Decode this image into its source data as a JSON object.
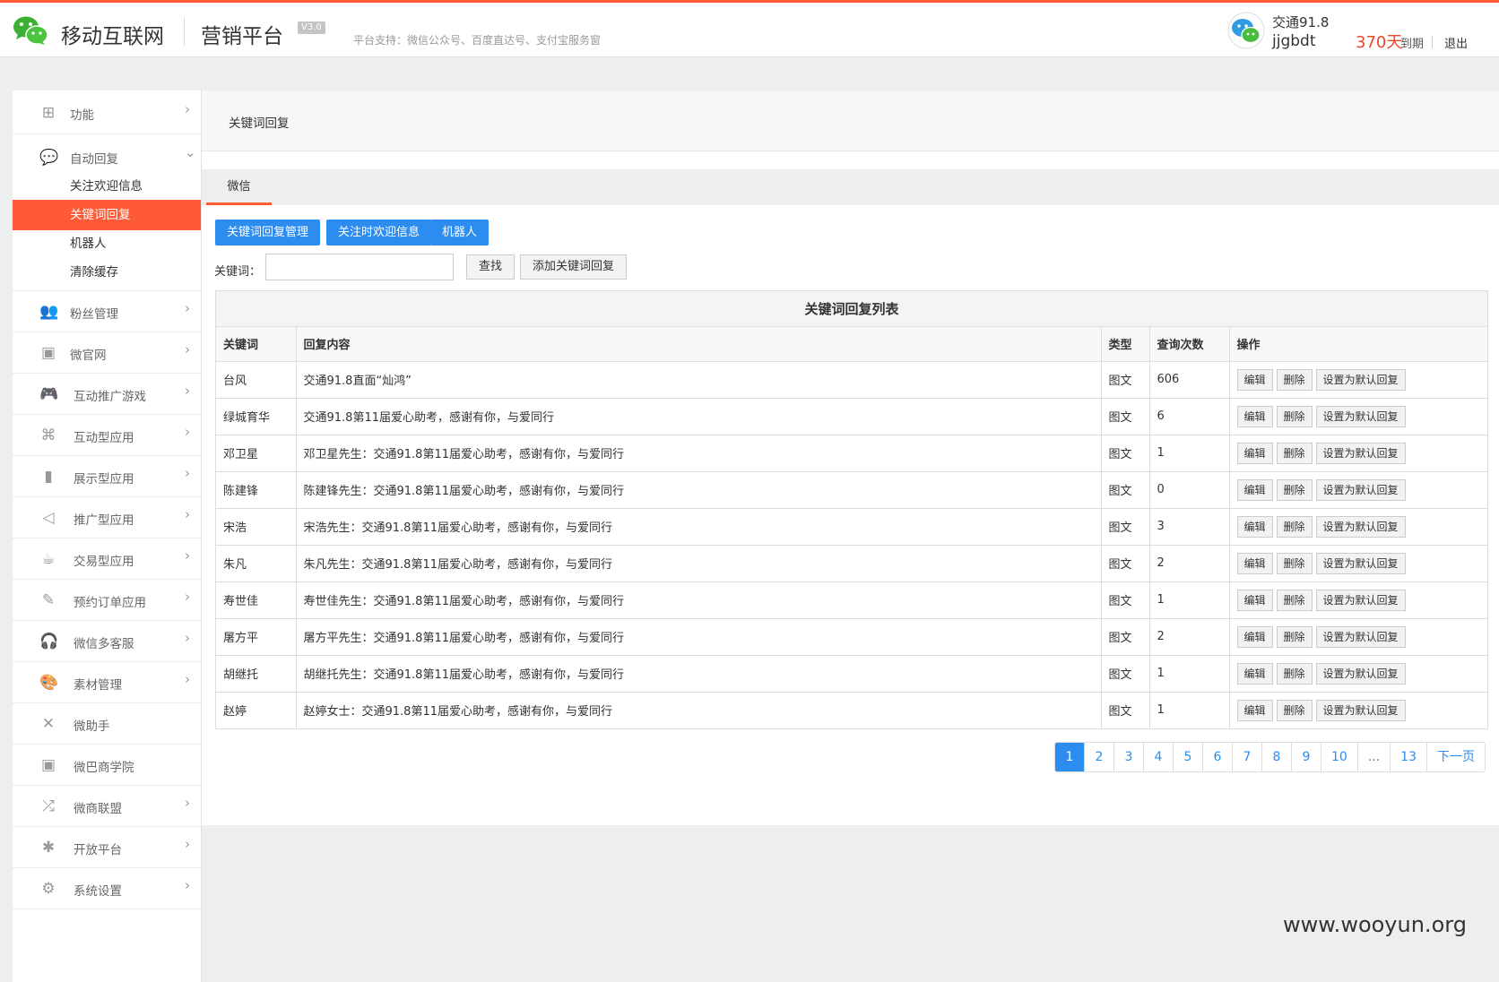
{
  "header": {
    "brand": "移动互联网",
    "platform": "营销平台",
    "version": "V3.0",
    "support": "平台支持：微信公众号、百度直达号、支付宝服务窗",
    "user_name": "交通91.8",
    "user_login": "jjgbdt",
    "days": "370天",
    "days_label": "到期",
    "logout": "退出",
    "accent_color": "#ff5a36"
  },
  "sidebar": {
    "top": [
      {
        "label": "功能",
        "icon": "grid-icon"
      },
      {
        "label": "自动回复",
        "icon": "chat-icon"
      }
    ],
    "sub": [
      {
        "label": "关注欢迎信息"
      },
      {
        "label": "关键词回复"
      },
      {
        "label": "机器人"
      },
      {
        "label": "清除缓存"
      }
    ],
    "items": [
      {
        "label": "粉丝管理",
        "icon": "users-icon"
      },
      {
        "label": "微官网",
        "icon": "web-icon"
      },
      {
        "label": "互动推广游戏",
        "icon": "gamepad-icon"
      },
      {
        "label": "互动型应用",
        "icon": "command-icon"
      },
      {
        "label": "展示型应用",
        "icon": "book-icon"
      },
      {
        "label": "推广型应用",
        "icon": "share-icon"
      },
      {
        "label": "交易型应用",
        "icon": "cart-icon"
      },
      {
        "label": "预约订单应用",
        "icon": "edit-icon"
      },
      {
        "label": "微信多客服",
        "icon": "headset-icon"
      },
      {
        "label": "素材管理",
        "icon": "palette-icon"
      },
      {
        "label": "微助手",
        "icon": "tools-icon"
      },
      {
        "label": "微巴商学院",
        "icon": "school-icon"
      },
      {
        "label": "微商联盟",
        "icon": "shuffle-icon"
      },
      {
        "label": "开放平台",
        "icon": "puzzle-icon"
      },
      {
        "label": "系统设置",
        "icon": "gear-icon"
      }
    ]
  },
  "main": {
    "breadcrumb": "关键词回复",
    "tab": "微信",
    "buttons": {
      "manage": "关键词回复管理",
      "welcome": "关注时欢迎信息",
      "robot": "机器人"
    },
    "search": {
      "label": "关键词：",
      "value": "",
      "search_button": "查找",
      "add_button": "添加关键词回复"
    },
    "list_title": "关键词回复列表",
    "columns": [
      "关键词",
      "回复内容",
      "类型",
      "查询次数",
      "操作"
    ],
    "rows": [
      {
        "keyword": "台风",
        "content": "交通91.8直面“灿鸿”",
        "type": "图文",
        "count": "606"
      },
      {
        "keyword": "绿城育华",
        "content": "交通91.8第11届爱心助考，感谢有你，与爱同行",
        "type": "图文",
        "count": "6"
      },
      {
        "keyword": "邓卫星",
        "content": "邓卫星先生：交通91.8第11届爱心助考，感谢有你，与爱同行",
        "type": "图文",
        "count": "1"
      },
      {
        "keyword": "陈建锋",
        "content": "陈建锋先生：交通91.8第11届爱心助考，感谢有你，与爱同行",
        "type": "图文",
        "count": "0"
      },
      {
        "keyword": "宋浩",
        "content": "宋浩先生：交通91.8第11届爱心助考，感谢有你，与爱同行",
        "type": "图文",
        "count": "3"
      },
      {
        "keyword": "朱凡",
        "content": "朱凡先生：交通91.8第11届爱心助考，感谢有你，与爱同行",
        "type": "图文",
        "count": "2"
      },
      {
        "keyword": "寿世佳",
        "content": "寿世佳先生：交通91.8第11届爱心助考，感谢有你，与爱同行",
        "type": "图文",
        "count": "1"
      },
      {
        "keyword": "屠方平",
        "content": "屠方平先生：交通91.8第11届爱心助考，感谢有你，与爱同行",
        "type": "图文",
        "count": "2"
      },
      {
        "keyword": "胡继托",
        "content": "胡继托先生：交通91.8第11届爱心助考，感谢有你，与爱同行",
        "type": "图文",
        "count": "1"
      },
      {
        "keyword": "赵婷",
        "content": "赵婷女士：交通91.8第11届爱心助考，感谢有你，与爱同行",
        "type": "图文",
        "count": "1"
      }
    ],
    "ops": {
      "edit": "编辑",
      "delete": "删除",
      "set_default": "设置为默认回复"
    },
    "pagination": [
      "1",
      "2",
      "3",
      "4",
      "5",
      "6",
      "7",
      "8",
      "9",
      "10",
      "...",
      "13",
      "下一页"
    ]
  },
  "watermark": "www.wooyun.org"
}
